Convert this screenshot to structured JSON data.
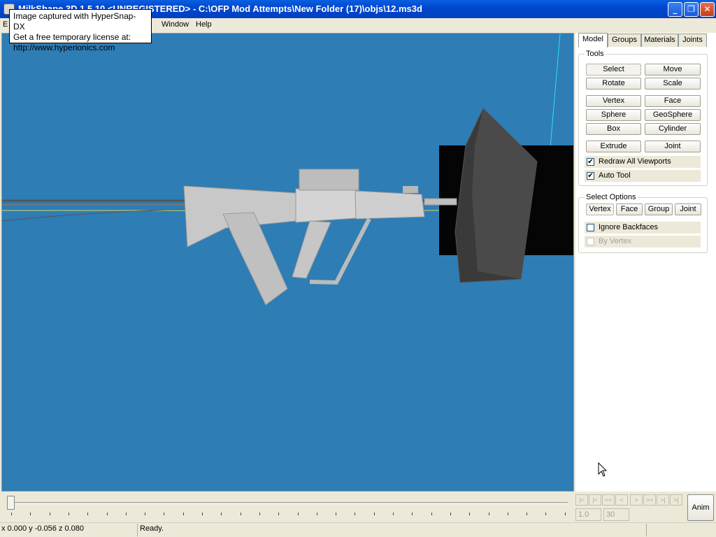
{
  "window": {
    "title": "MilkShape 3D 1.5.10 <UNREGISTERED> - C:\\OFP Mod Attempts\\New Folder (17)\\objs\\12.ms3d",
    "minimize_glyph": "_",
    "maximize_glyph": "❐",
    "close_glyph": "✕"
  },
  "tooltip": {
    "line1": "Image captured with HyperSnap-DX",
    "line2": "Get a free temporary license at:",
    "line3": "http://www.hyperionics.com"
  },
  "menu": {
    "file": "E",
    "window": "Window",
    "help": "Help"
  },
  "tabs": [
    "Model",
    "Groups",
    "Materials",
    "Joints"
  ],
  "tools": {
    "group_label": "Tools",
    "select": "Select",
    "move": "Move",
    "rotate": "Rotate",
    "scale": "Scale",
    "vertex": "Vertex",
    "face": "Face",
    "sphere": "Sphere",
    "geosphere": "GeoSphere",
    "box": "Box",
    "cylinder": "Cylinder",
    "extrude": "Extrude",
    "joint": "Joint",
    "redraw_all": "Redraw All Viewports",
    "auto_tool": "Auto Tool"
  },
  "select_options": {
    "group_label": "Select Options",
    "vertex": "Vertex",
    "face": "Face",
    "group": "Group",
    "joint": "Joint",
    "ignore_backfaces": "Ignore Backfaces",
    "by_vertex": "By Vertex"
  },
  "animation": {
    "first": "|<",
    "prev_key": "|<",
    "rewind": "<<",
    "prev": "<",
    "next": ">",
    "forward": ">>",
    "next_key": ">|",
    "last": ">|",
    "frame": "1.0",
    "total": "30",
    "anim_label": "Anim"
  },
  "status": {
    "coords": "x 0.000 y -0.056 z 0.080",
    "message": "Ready."
  },
  "colors": {
    "viewport_bg": "#2e7db5",
    "titlebar": "#0048d0",
    "model_gray": "#cfcfcf",
    "shield_dark": "#3a3a3a"
  }
}
